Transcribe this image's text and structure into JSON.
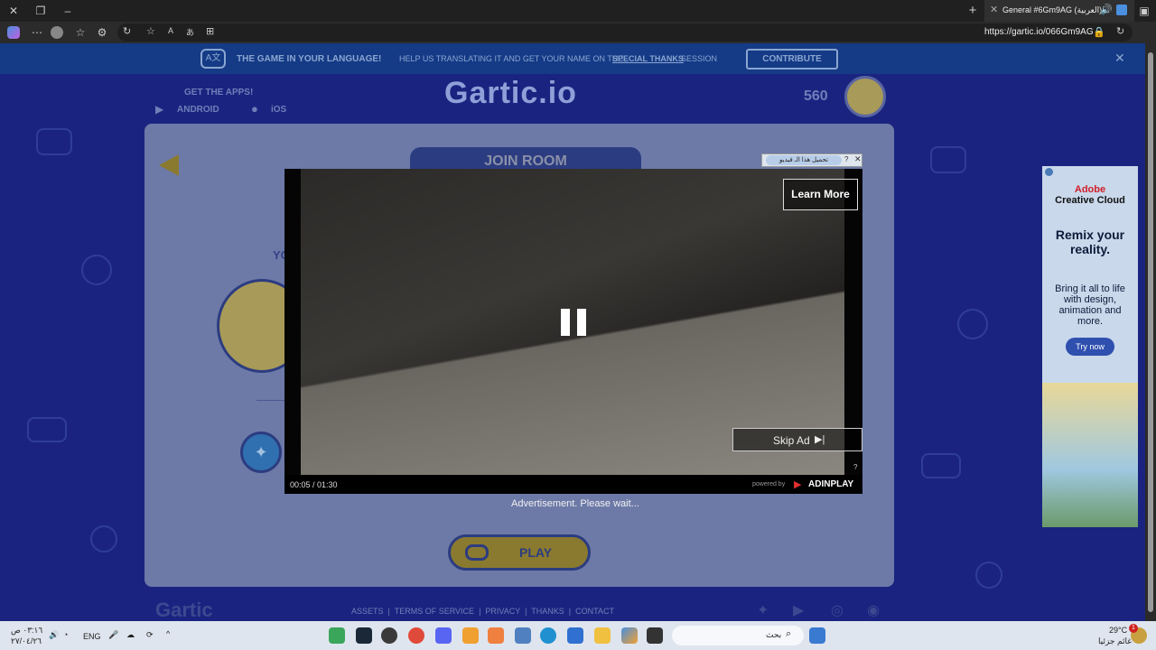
{
  "browser": {
    "tab_title": "General #6Gm9AG (العربية)",
    "url": "https://gartic.io/066Gm9AG"
  },
  "banner": {
    "headline": "THE GAME IN YOUR LANGUAGE!",
    "text": "HELP US TRANSLATING IT AND GET YOUR NAME ON THE",
    "link": "SPECIAL THANKS",
    "suffix": "SESSION",
    "button": "CONTRIBUTE"
  },
  "header": {
    "get_apps": "GET THE APPS!",
    "android": "ANDROID",
    "ios": "iOS",
    "logo": "Gartic.io",
    "score": "560"
  },
  "room": {
    "join_title": "JOIN ROOM",
    "your_label": "YO",
    "play": "PLAY"
  },
  "ad_video": {
    "learn_more": "Learn More",
    "skip": "Skip Ad",
    "time": "00:05 / 01:30",
    "powered": "powered by",
    "brand": "ADINPLAY",
    "wait": "Advertisement. Please wait...",
    "download_chip": "تحميل هذا الـ فيديو"
  },
  "footer": {
    "logo": "Gartic",
    "links": [
      "ASSETS",
      "TERMS OF SERVICE",
      "PRIVACY",
      "THANKS",
      "CONTACT"
    ]
  },
  "side_ad": {
    "brand1": "Adobe",
    "brand2": "Creative Cloud",
    "headline": "Remix your reality.",
    "body": "Bring it all to life with design, animation and more.",
    "cta": "Try now"
  },
  "taskbar": {
    "time": "٠٣:١٦ ص",
    "date": "٢٧/٠٤/٢٦",
    "lang": "ENG",
    "search": "بحث",
    "temp": "29°C",
    "weather": "غائم جزئيا",
    "badge": "1"
  }
}
